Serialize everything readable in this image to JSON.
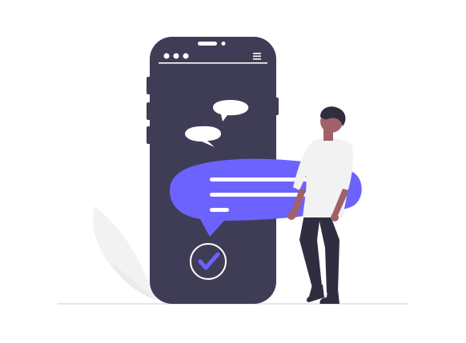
{
  "illustration": {
    "icons": {
      "phone": "smartphone-icon",
      "chat_small_1": "chat-bubble-icon",
      "chat_small_2": "chat-bubble-icon",
      "chat_large": "message-bubble-icon",
      "check": "checkmark-circle-icon",
      "menu": "hamburger-menu-icon",
      "person": "person-figure",
      "plant": "leaf-icon"
    },
    "colors": {
      "background": "#ffffff",
      "phone": "#3f3d56",
      "accent": "#6c63ff",
      "bubble_light": "#ffffff",
      "leaf": "#f2f2f2",
      "ground": "#e6e6e6",
      "skin": "#a0616a",
      "hair": "#2f2e41",
      "shirt": "#f2f2f2",
      "pants": "#2f2e41"
    }
  }
}
